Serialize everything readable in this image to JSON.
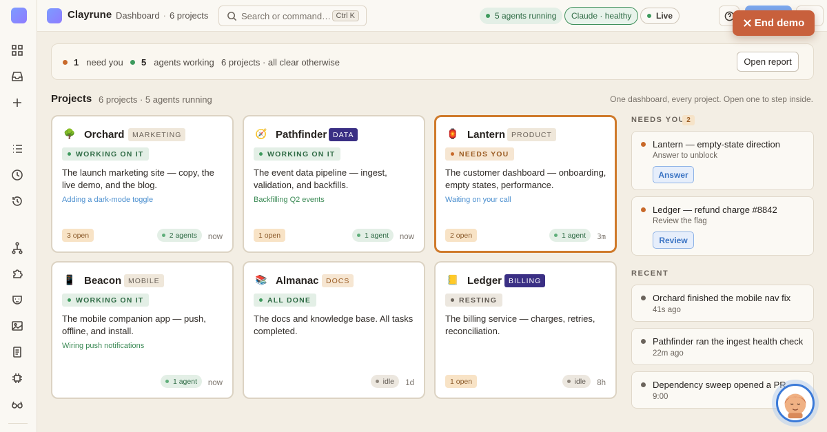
{
  "app": {
    "name": "Clayrune"
  },
  "breadcrumb": {
    "page": "Dashboard",
    "count": "6 projects"
  },
  "search": {
    "placeholder": "Search or command…",
    "shortcut": "Ctrl K"
  },
  "status": {
    "agents": "5 agents running",
    "claude": "Claude · healthy",
    "live": "Live"
  },
  "end_demo": "End demo",
  "summary": {
    "need_count": "1",
    "need_label": "need you",
    "working_count": "5",
    "working_label": "agents working",
    "other": "6 projects · all clear otherwise",
    "open_report": "Open report"
  },
  "projects_header": {
    "title": "Projects",
    "sub": "6 projects · 5 agents running",
    "hint": "One dashboard, every project. Open one to step inside."
  },
  "projects": [
    {
      "emoji": "🌳",
      "name": "Orchard",
      "tag": "MARKETING",
      "status": "WORKING ON IT",
      "desc": "The launch marketing site — copy, the live demo, and the blog.",
      "activity": "Adding a dark-mode toggle",
      "open": "3 open",
      "agents": "2 agents",
      "time": "now"
    },
    {
      "emoji": "🧭",
      "name": "Pathfinder",
      "tag": "DATA",
      "status": "WORKING ON IT",
      "desc": "The event data pipeline — ingest, validation, and backfills.",
      "activity": "Backfilling Q2 events",
      "open": "1 open",
      "agents": "1 agent",
      "time": "now"
    },
    {
      "emoji": "🏮",
      "name": "Lantern",
      "tag": "PRODUCT",
      "status": "NEEDS YOU",
      "desc": "The customer dashboard — onboarding, empty states, performance.",
      "activity": "Waiting on your call",
      "open": "2 open",
      "agents": "1 agent",
      "time": "3m"
    },
    {
      "emoji": "📱",
      "name": "Beacon",
      "tag": "MOBILE",
      "status": "WORKING ON IT",
      "desc": "The mobile companion app — push, offline, and install.",
      "activity": "Wiring push notifications",
      "agents": "1 agent",
      "time": "now"
    },
    {
      "emoji": "📚",
      "name": "Almanac",
      "tag": "DOCS",
      "status": "ALL DONE",
      "desc": "The docs and knowledge base. All tasks completed.",
      "idle": "idle",
      "time": "1d"
    },
    {
      "emoji": "📒",
      "name": "Ledger",
      "tag": "BILLING",
      "status": "RESTING",
      "desc": "The billing service — charges, retries, reconciliation.",
      "open": "1 open",
      "idle": "idle",
      "time": "8h"
    }
  ],
  "needs_you": {
    "label": "NEEDS YOU",
    "count": "2",
    "items": [
      {
        "title": "Lantern — empty-state direction",
        "sub": "Answer to unblock",
        "button": "Answer"
      },
      {
        "title": "Ledger — refund charge #8842",
        "sub": "Review the flag",
        "button": "Review"
      }
    ]
  },
  "recent": {
    "label": "RECENT",
    "items": [
      {
        "title": "Orchard finished the mobile nav fix",
        "sub": "41s ago"
      },
      {
        "title": "Pathfinder ran the ingest health check",
        "sub": "22m ago"
      },
      {
        "title": "Dependency sweep opened a PR",
        "sub": "9:00"
      }
    ]
  },
  "colors": {
    "accent": "#c8603c",
    "needs": "#cf7a2b",
    "ok": "#3d9a5d",
    "brand": "#7c9cff"
  }
}
